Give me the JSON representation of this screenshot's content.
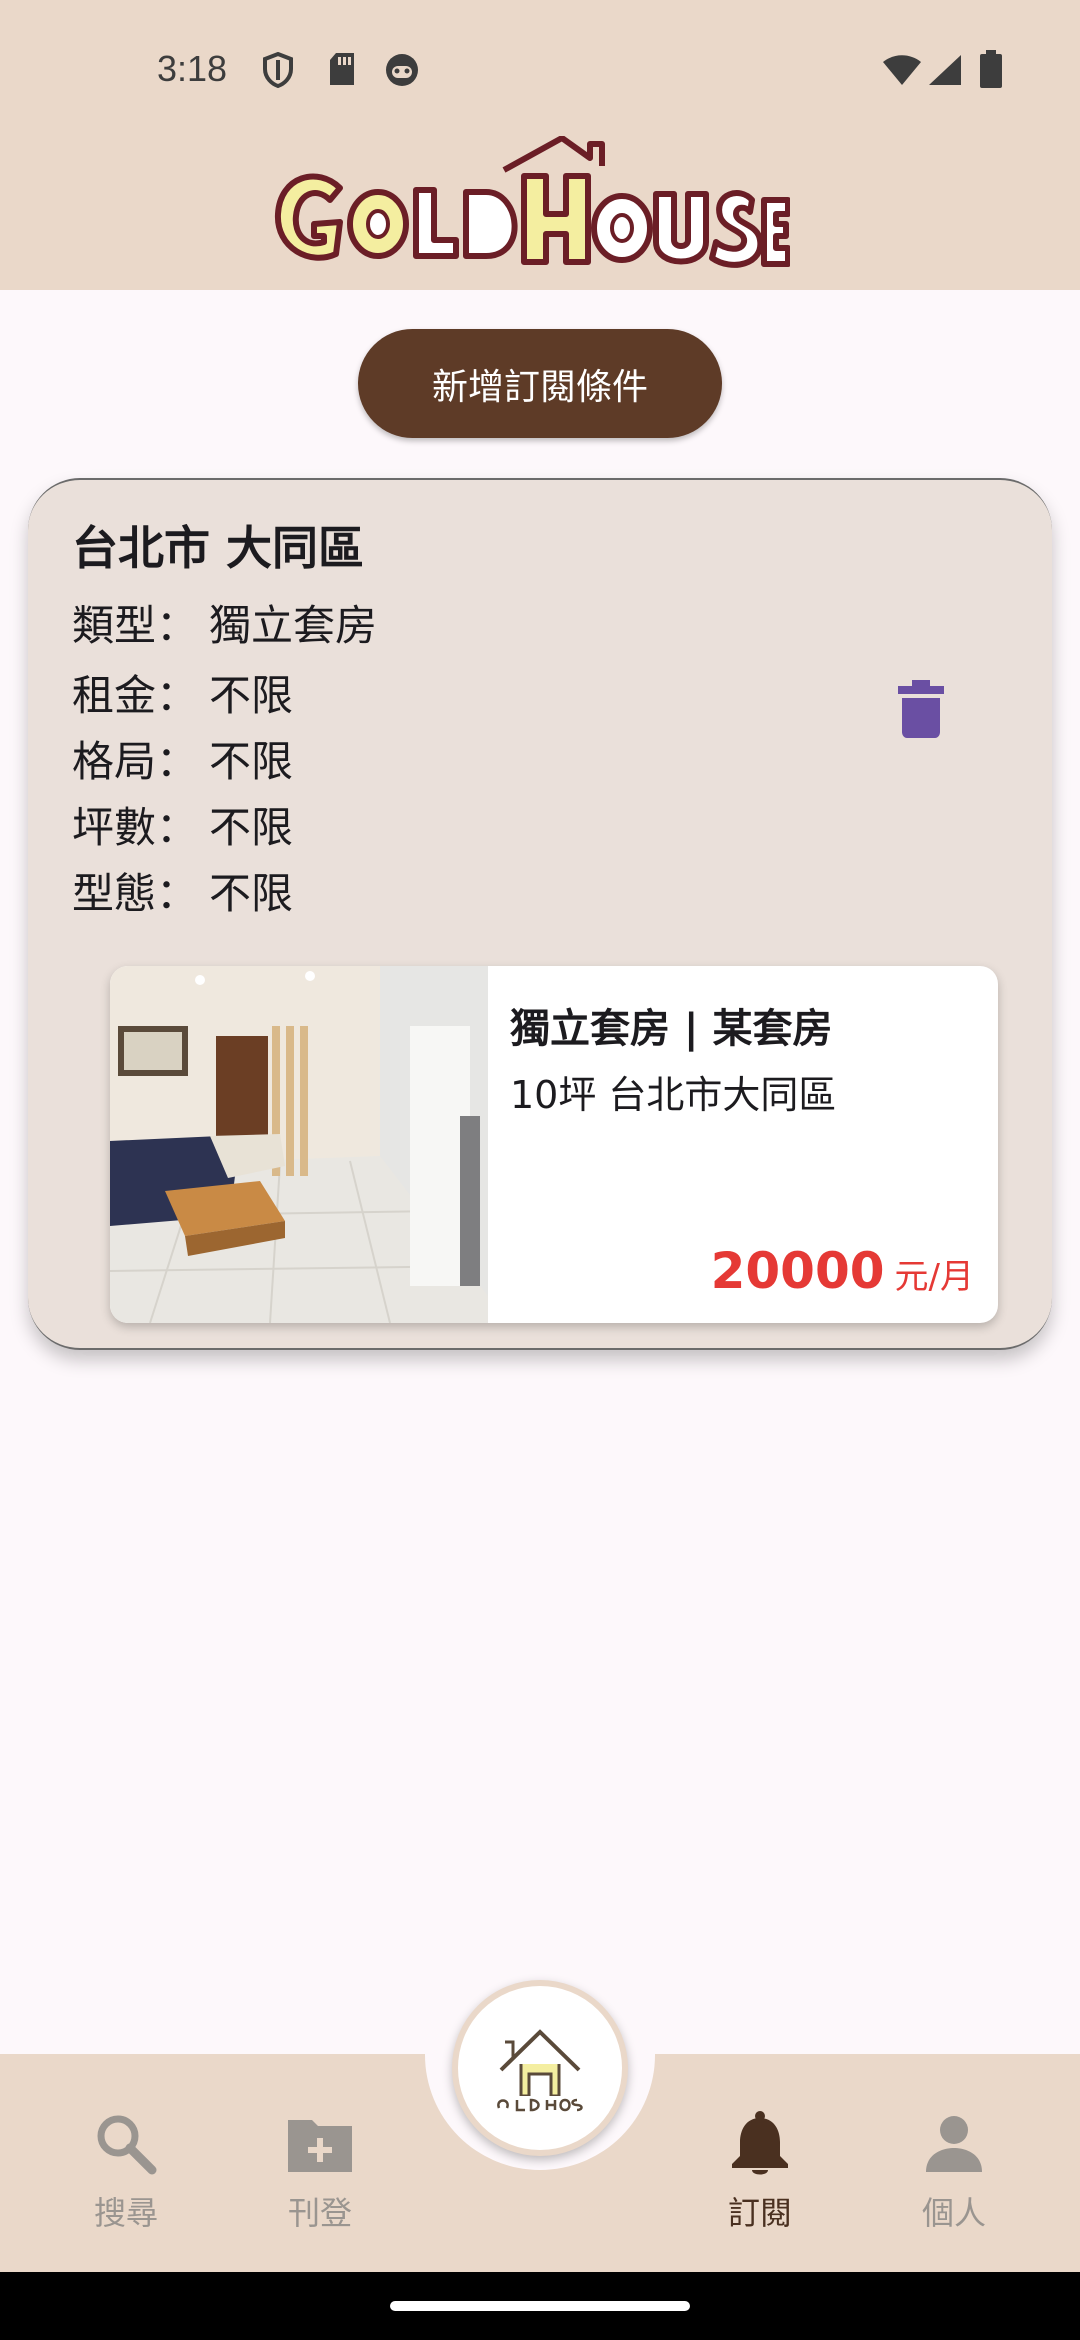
{
  "status_bar": {
    "time": "3:18",
    "icons": [
      "shield-icon",
      "sd-card-icon",
      "face-icon",
      "wifi-icon",
      "signal-icon",
      "battery-icon"
    ]
  },
  "header": {
    "logo_text": "GOLD HOUSE"
  },
  "actions": {
    "add_subscription": "新增訂閱條件"
  },
  "subscription": {
    "location": "台北市 大同區",
    "rows": [
      {
        "key": "類型：",
        "value": "獨立套房"
      },
      {
        "key": "租金：",
        "value": "不限"
      },
      {
        "key": "格局：",
        "value": "不限"
      },
      {
        "key": "坪數：",
        "value": "不限"
      },
      {
        "key": "型態：",
        "value": "不限"
      }
    ],
    "delete_icon": "trash-icon"
  },
  "listing": {
    "title": "獨立套房 | 某套房",
    "subtitle": "10坪 台北市大同區",
    "price": "20000",
    "price_unit": "元/月"
  },
  "bottom_nav": {
    "items": [
      {
        "label": "搜尋",
        "icon": "search-icon",
        "active": false
      },
      {
        "label": "刊登",
        "icon": "folder-add-icon",
        "active": false
      },
      {
        "label": "訂閱",
        "icon": "bell-icon",
        "active": true
      },
      {
        "label": "個人",
        "icon": "person-icon",
        "active": false
      }
    ],
    "center_logo": "GOLD HOUSE"
  },
  "colors": {
    "header_bg": "#ead8c9",
    "button_brown": "#5e3b27",
    "card_bg": "#eae0da",
    "price_red": "#e53935",
    "trash_purple": "#6a4fa3",
    "logo_yellow": "#f4eea0"
  }
}
